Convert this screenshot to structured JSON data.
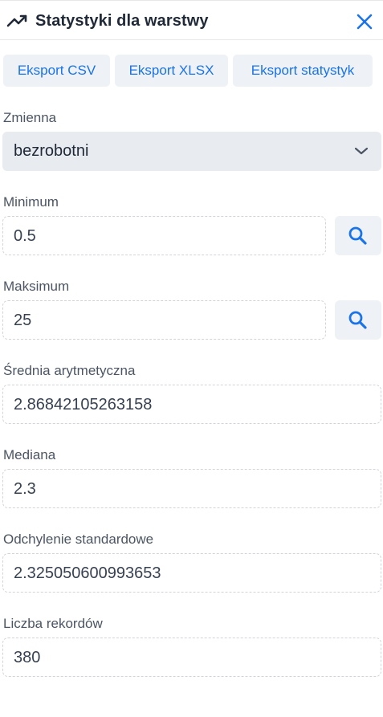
{
  "header": {
    "title": "Statystyki dla warstwy",
    "icon": "trending-up-icon",
    "close_icon": "close-icon"
  },
  "export_buttons": [
    {
      "label": "Eksport CSV"
    },
    {
      "label": "Eksport XLSX"
    },
    {
      "label": "Eksport statystyk"
    }
  ],
  "variable": {
    "label": "Zmienna",
    "selected": "bezrobotni"
  },
  "minimum": {
    "label": "Minimum",
    "value": "0.5"
  },
  "maximum": {
    "label": "Maksimum",
    "value": "25"
  },
  "mean": {
    "label": "Średnia arytmetyczna",
    "value": "2.86842105263158"
  },
  "median": {
    "label": "Mediana",
    "value": "2.3"
  },
  "std_dev": {
    "label": "Odchylenie standardowe",
    "value": "2.325050600993653"
  },
  "record_count": {
    "label": "Liczba rekordów",
    "value": "380"
  },
  "colors": {
    "accent": "#1a73e8",
    "button_bg": "#eef2f6",
    "text": "#1f2937"
  }
}
